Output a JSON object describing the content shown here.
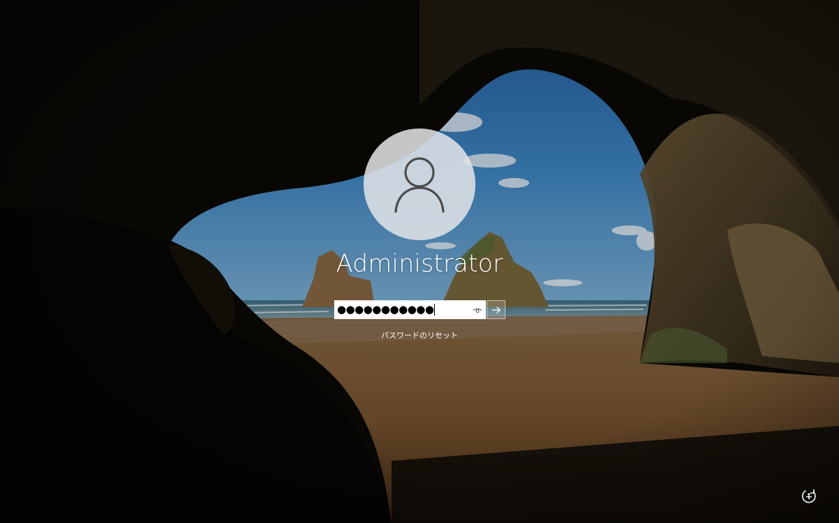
{
  "login": {
    "username": "Administrator",
    "password_mask": "●●●●●●●●●●●",
    "reset_password_link": "パスワードのリセット"
  },
  "icons": {
    "avatar": "user-silhouette-icon",
    "reveal": "eye-icon",
    "submit": "arrow-right-icon",
    "accessibility": "ease-of-access-icon"
  },
  "colors": {
    "text": "#ffffff",
    "avatar_bg": "#e2e4e8",
    "field_bg": "#ffffff"
  }
}
